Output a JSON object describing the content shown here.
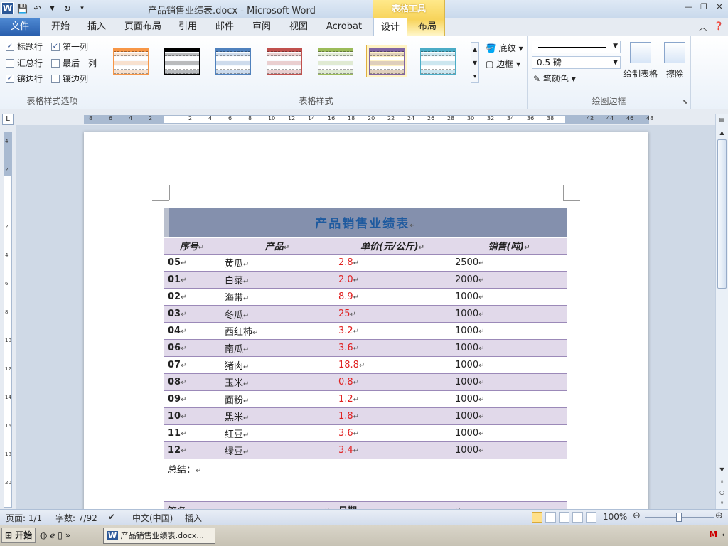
{
  "app": {
    "title": "产品销售业绩表.docx - Microsoft Word",
    "tools_tab": "表格工具",
    "logo": "W"
  },
  "tabs": [
    "文件",
    "开始",
    "插入",
    "页面布局",
    "引用",
    "邮件",
    "审阅",
    "视图",
    "Acrobat",
    "设计",
    "布局"
  ],
  "active_tab": "设计",
  "ribbon": {
    "options_group": {
      "label": "表格样式选项",
      "checks": [
        {
          "label": "标题行",
          "checked": true
        },
        {
          "label": "第一列",
          "checked": true
        },
        {
          "label": "汇总行",
          "checked": false
        },
        {
          "label": "最后一列",
          "checked": false
        },
        {
          "label": "镶边行",
          "checked": true
        },
        {
          "label": "镶边列",
          "checked": false
        }
      ]
    },
    "styles_group": {
      "label": "表格样式",
      "swatches": [
        "#f79646",
        "#000000",
        "#4f81bd",
        "#c0504d",
        "#9bbb59",
        "#8064a2",
        "#4bacc6"
      ],
      "shading": "底纹",
      "borders": "边框"
    },
    "draw_group": {
      "label": "绘图边框",
      "weight": "0.5 磅",
      "pen_color": "笔颜色",
      "draw_table": "绘制表格",
      "eraser": "擦除"
    }
  },
  "document": {
    "title": "产品销售业绩表",
    "headers": [
      "序号",
      "产品",
      "单价(元/公斤)",
      "销售(吨)"
    ],
    "rows": [
      [
        "05",
        "黄瓜",
        "2.8",
        "2500"
      ],
      [
        "01",
        "白菜",
        "2.0",
        "2000"
      ],
      [
        "02",
        "海带",
        "8.9",
        "1000"
      ],
      [
        "03",
        "冬瓜",
        "25",
        "1000"
      ],
      [
        "04",
        "西红柿",
        "3.2",
        "1000"
      ],
      [
        "06",
        "南瓜",
        "3.6",
        "1000"
      ],
      [
        "07",
        "猪肉",
        "18.8",
        "1000"
      ],
      [
        "08",
        "玉米",
        "0.8",
        "1000"
      ],
      [
        "09",
        "面粉",
        "1.2",
        "1000"
      ],
      [
        "10",
        "黑米",
        "1.8",
        "1000"
      ],
      [
        "11",
        "红豆",
        "3.6",
        "1000"
      ],
      [
        "12",
        "绿豆",
        "3.4",
        "1000"
      ]
    ],
    "summary_label": "总结：",
    "sign_label": "签名",
    "date_label": "日期",
    "para_mark": "↵"
  },
  "statusbar": {
    "page": "页面: 1/1",
    "words": "字数: 7/92",
    "language": "中文(中国)",
    "mode": "插入",
    "zoom": "100%"
  },
  "taskbar": {
    "start": "开始",
    "item": "产品销售业绩表.docx..."
  },
  "colors": {
    "accent": "#2a5fae",
    "title_band": "#8490ad",
    "band": "#e1d9ea",
    "price": "#e02020"
  }
}
